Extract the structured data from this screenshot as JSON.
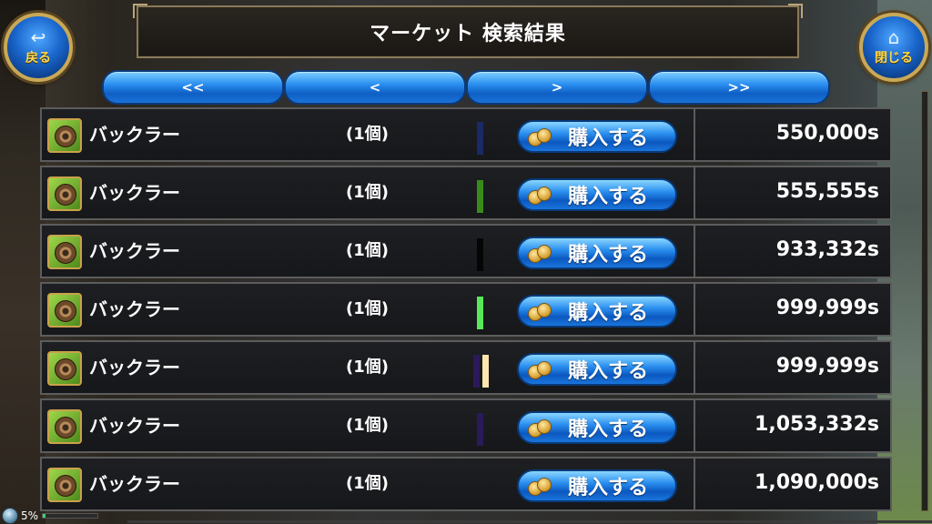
{
  "header": {
    "title": "マーケット 検索結果"
  },
  "buttons": {
    "back_label": "戻る",
    "close_label": "閉じる"
  },
  "pager": {
    "first": "<<",
    "prev": "<",
    "next": ">",
    "last": ">>"
  },
  "rows": [
    {
      "name": "バックラー",
      "qty": "(1個)",
      "buy": "購入する",
      "price": "550,000s",
      "markers": [
        "#1a2a66"
      ]
    },
    {
      "name": "バックラー",
      "qty": "(1個)",
      "buy": "購入する",
      "price": "555,555s",
      "markers": [
        "#3a8a1a"
      ]
    },
    {
      "name": "バックラー",
      "qty": "(1個)",
      "buy": "購入する",
      "price": "933,332s",
      "markers": [
        "#050505"
      ]
    },
    {
      "name": "バックラー",
      "qty": "(1個)",
      "buy": "購入する",
      "price": "999,999s",
      "markers": [
        "#59e85a"
      ]
    },
    {
      "name": "バックラー",
      "qty": "(1個)",
      "buy": "購入する",
      "price": "999,999s",
      "markers": [
        "#2a1a5a",
        "#ffe6b0"
      ]
    },
    {
      "name": "バックラー",
      "qty": "(1個)",
      "buy": "購入する",
      "price": "1,053,332s",
      "markers": [
        "#2a1a5a"
      ]
    },
    {
      "name": "バックラー",
      "qty": "(1個)",
      "buy": "購入する",
      "price": "1,090,000s",
      "markers": []
    }
  ],
  "status": {
    "percent": "5%",
    "fill": 0.05
  }
}
